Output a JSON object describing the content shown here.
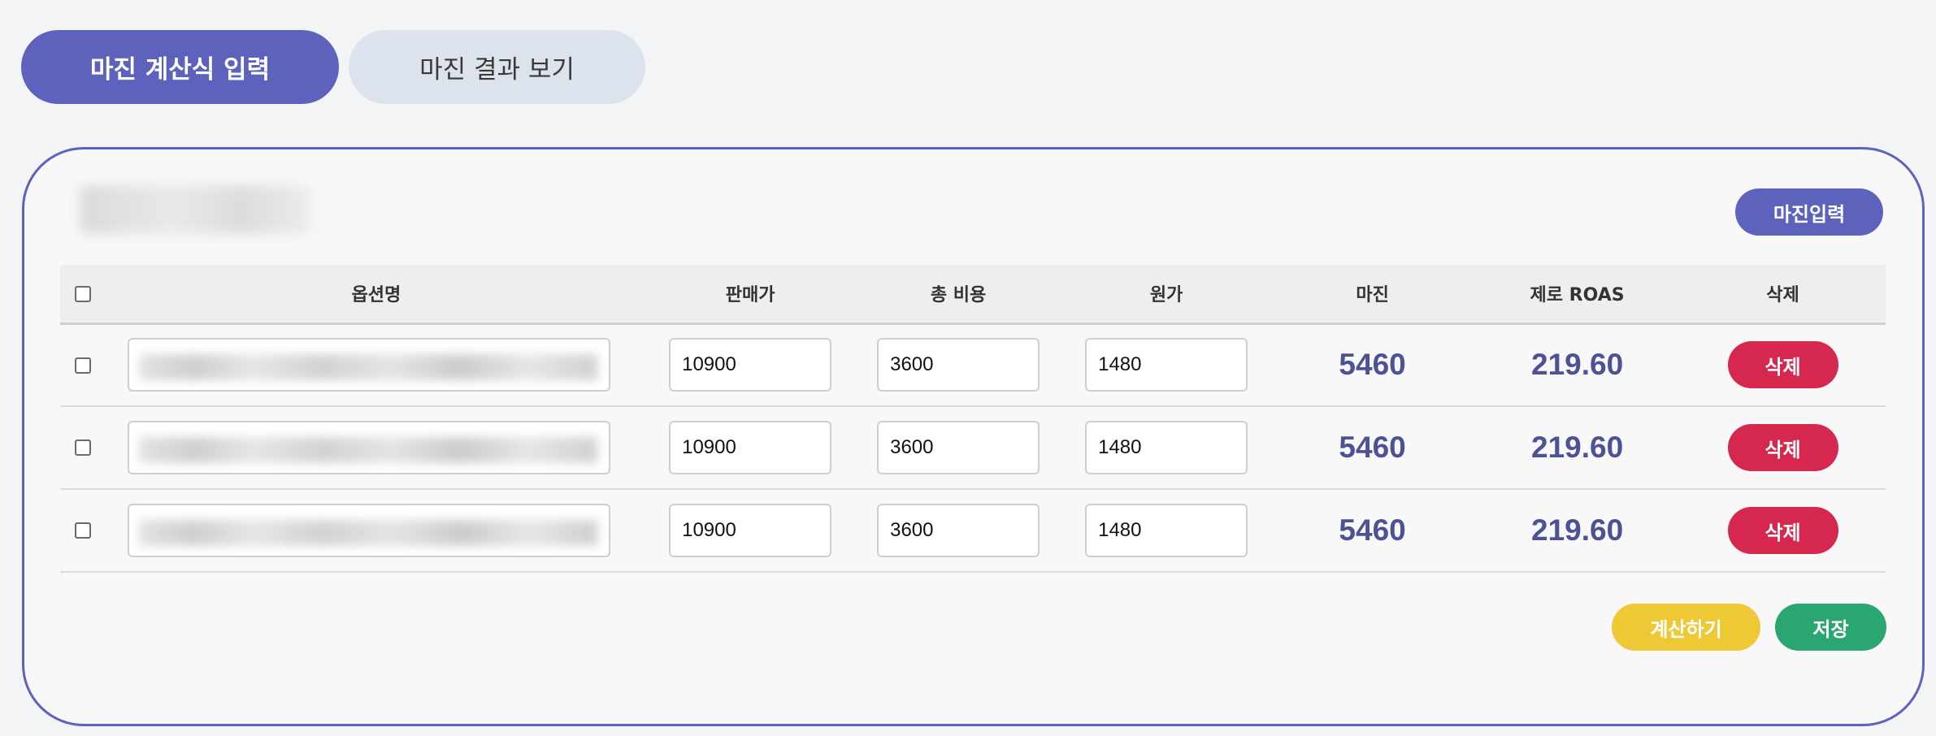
{
  "tabs": [
    {
      "label": "마진 계산식 입력",
      "active": true
    },
    {
      "label": "마진 결과 보기",
      "active": false
    }
  ],
  "card": {
    "margin_input_button": "마진입력"
  },
  "table": {
    "headers": {
      "option_name": "옵션명",
      "sale_price": "판매가",
      "total_cost": "총 비용",
      "cost_price": "원가",
      "margin": "마진",
      "zero_roas": "제로 ROAS",
      "delete": "삭제"
    },
    "rows": [
      {
        "sale_price": "10900",
        "total_cost": "3600",
        "cost_price": "1480",
        "margin": "5460",
        "zero_roas": "219.60",
        "delete_label": "삭제"
      },
      {
        "sale_price": "10900",
        "total_cost": "3600",
        "cost_price": "1480",
        "margin": "5460",
        "zero_roas": "219.60",
        "delete_label": "삭제"
      },
      {
        "sale_price": "10900",
        "total_cost": "3600",
        "cost_price": "1480",
        "margin": "5460",
        "zero_roas": "219.60",
        "delete_label": "삭제"
      }
    ]
  },
  "actions": {
    "calculate": "계산하기",
    "save": "저장"
  },
  "colors": {
    "accent": "#5d62bd",
    "danger": "#d6284f",
    "calculate": "#eec935",
    "save": "#2aa672",
    "value_text": "#4d5294"
  }
}
